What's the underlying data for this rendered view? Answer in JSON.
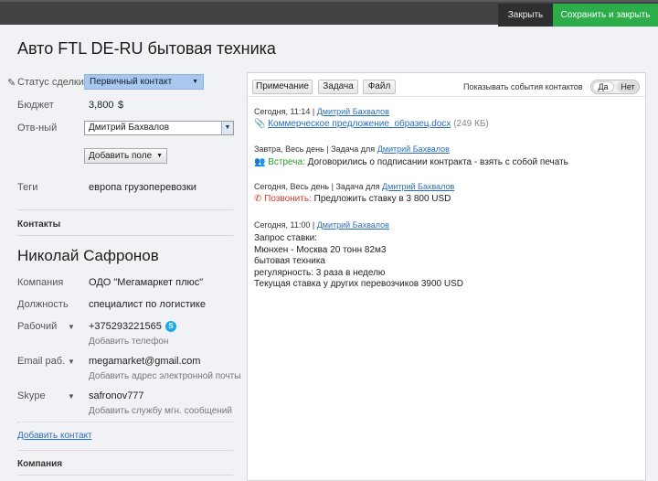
{
  "header": {
    "close_label": "Закрыть",
    "save_close_label": "Сохранить и закрыть"
  },
  "deal": {
    "title": "Авто FTL DE-RU бытовая техника",
    "status_label": "Статус сделки",
    "status_value": "Первичный контакт",
    "budget_label": "Бюджет",
    "budget_value": "3,800",
    "budget_currency": "$",
    "responsible_label": "Отв-ный",
    "responsible_value": "Дмитрий Бахвалов",
    "add_field_label": "Добавить поле",
    "tags_label": "Теги",
    "tags_value": "европа грузоперевозки"
  },
  "contacts": {
    "section_title": "Контакты",
    "name": "Николай Сафронов",
    "company_label": "Компания",
    "company_value": "ОДО \"Мегамаркет плюс\"",
    "position_label": "Должность",
    "position_value": "специалист по логистике",
    "phone_label": "Рабочий",
    "phone_value": "+375293221565",
    "add_phone": "Добавить телефон",
    "email_label": "Email раб.",
    "email_value": "megamarket@gmail.com",
    "add_email": "Добавить адрес электронной почты",
    "skype_label": "Skype",
    "skype_value": "safronov777",
    "add_im": "Добавить службу мгн. сообщений",
    "add_contact_link": "Добавить контакт",
    "company_section_title": "Компания"
  },
  "feed": {
    "tabs": [
      "Примечание",
      "Задача",
      "Файл"
    ],
    "show_events_label": "Показывать события контактов",
    "toggle_yes": "Да",
    "toggle_no": "Нет",
    "events": {
      "file": {
        "time": "Сегодня, 11:14 |",
        "author": "Дмитрий Бахвалов",
        "filename": "Коммерческое предложение_образец.docx",
        "size": "(249 КБ)"
      },
      "meeting": {
        "meta": "Завтра, Весь день | Задача для",
        "author": "Дмитрий Бахвалов",
        "type": "Встреча:",
        "text": "Договорились о подписании контракта - взять с собой печать"
      },
      "call": {
        "meta": "Сегодня, Весь день | Задача для",
        "author": "Дмитрий Бахвалов",
        "type": "Позвонить:",
        "text": "Предложить ставку в 3 800 USD"
      },
      "note": {
        "time": "Сегодня, 11:00 |",
        "author": "Дмитрий Бахвалов",
        "lines": [
          "Запрос ставки:",
          "Мюнхен - Москва 20 тонн 82м3",
          "бытовая техника",
          "регулярность: 3 раза в неделю",
          "Текущая ставка у других перевозчиков 3900 USD"
        ]
      }
    }
  }
}
